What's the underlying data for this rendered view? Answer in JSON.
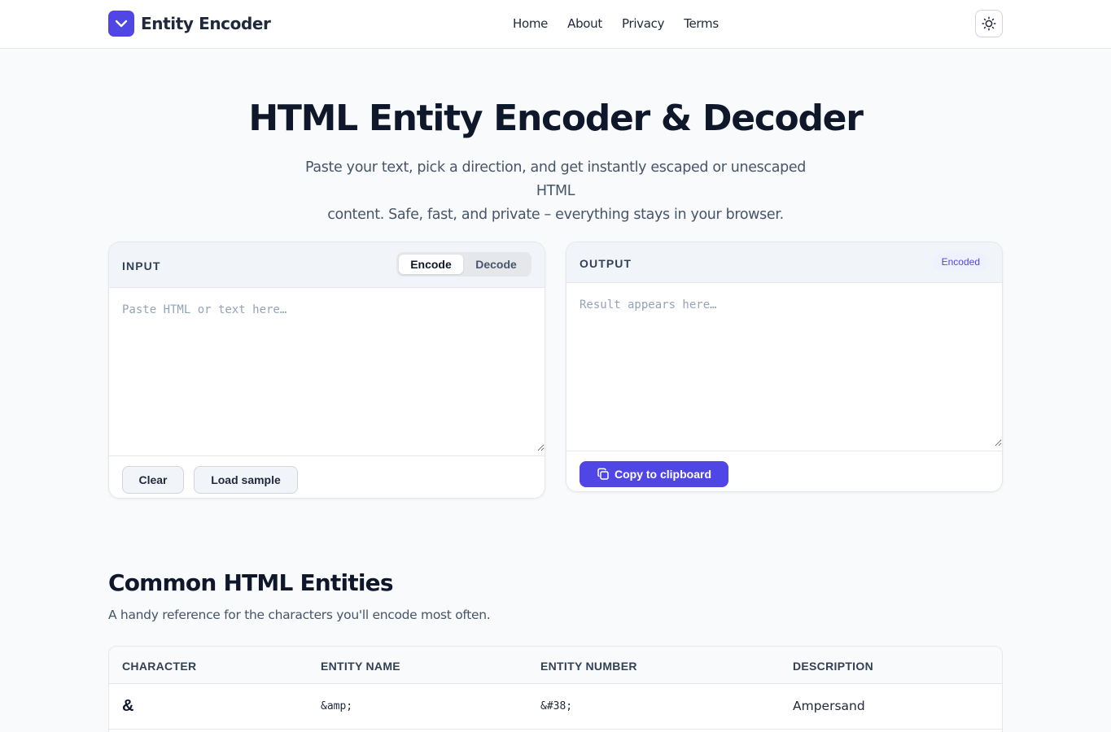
{
  "header": {
    "brand": "Entity Encoder",
    "nav": [
      "Home",
      "About",
      "Privacy",
      "Terms"
    ],
    "theme_toggle_icon": "sun-icon"
  },
  "hero": {
    "title": "HTML Entity Encoder & Decoder",
    "subtitle_line1": "Paste your text, pick a direction, and get instantly escaped or unescaped HTML",
    "subtitle_line2": "content. Safe, fast, and private – everything stays in your browser."
  },
  "input_panel": {
    "label": "INPUT",
    "modes": [
      "Encode",
      "Decode"
    ],
    "active_mode": "Encode",
    "value": "",
    "placeholder": "Paste HTML or text here…",
    "clear_label": "Clear",
    "sample_label": "Load sample"
  },
  "output_panel": {
    "label": "OUTPUT",
    "badge": "Encoded",
    "value": "",
    "placeholder": "Result appears here…",
    "copy_label": "Copy to clipboard",
    "copy_icon": "copy-icon"
  },
  "reference": {
    "title": "Common HTML Entities",
    "subtitle": "A handy reference for the characters you'll encode most often.",
    "columns": [
      "CHARACTER",
      "ENTITY NAME",
      "ENTITY NUMBER",
      "DESCRIPTION"
    ],
    "rows": [
      {
        "character": "&",
        "name": "&amp;",
        "number": "&#38;",
        "description": "Ampersand"
      }
    ]
  },
  "colors": {
    "accent": "#4f46e5",
    "background": "#f8fafc",
    "text": "#0f172a"
  }
}
